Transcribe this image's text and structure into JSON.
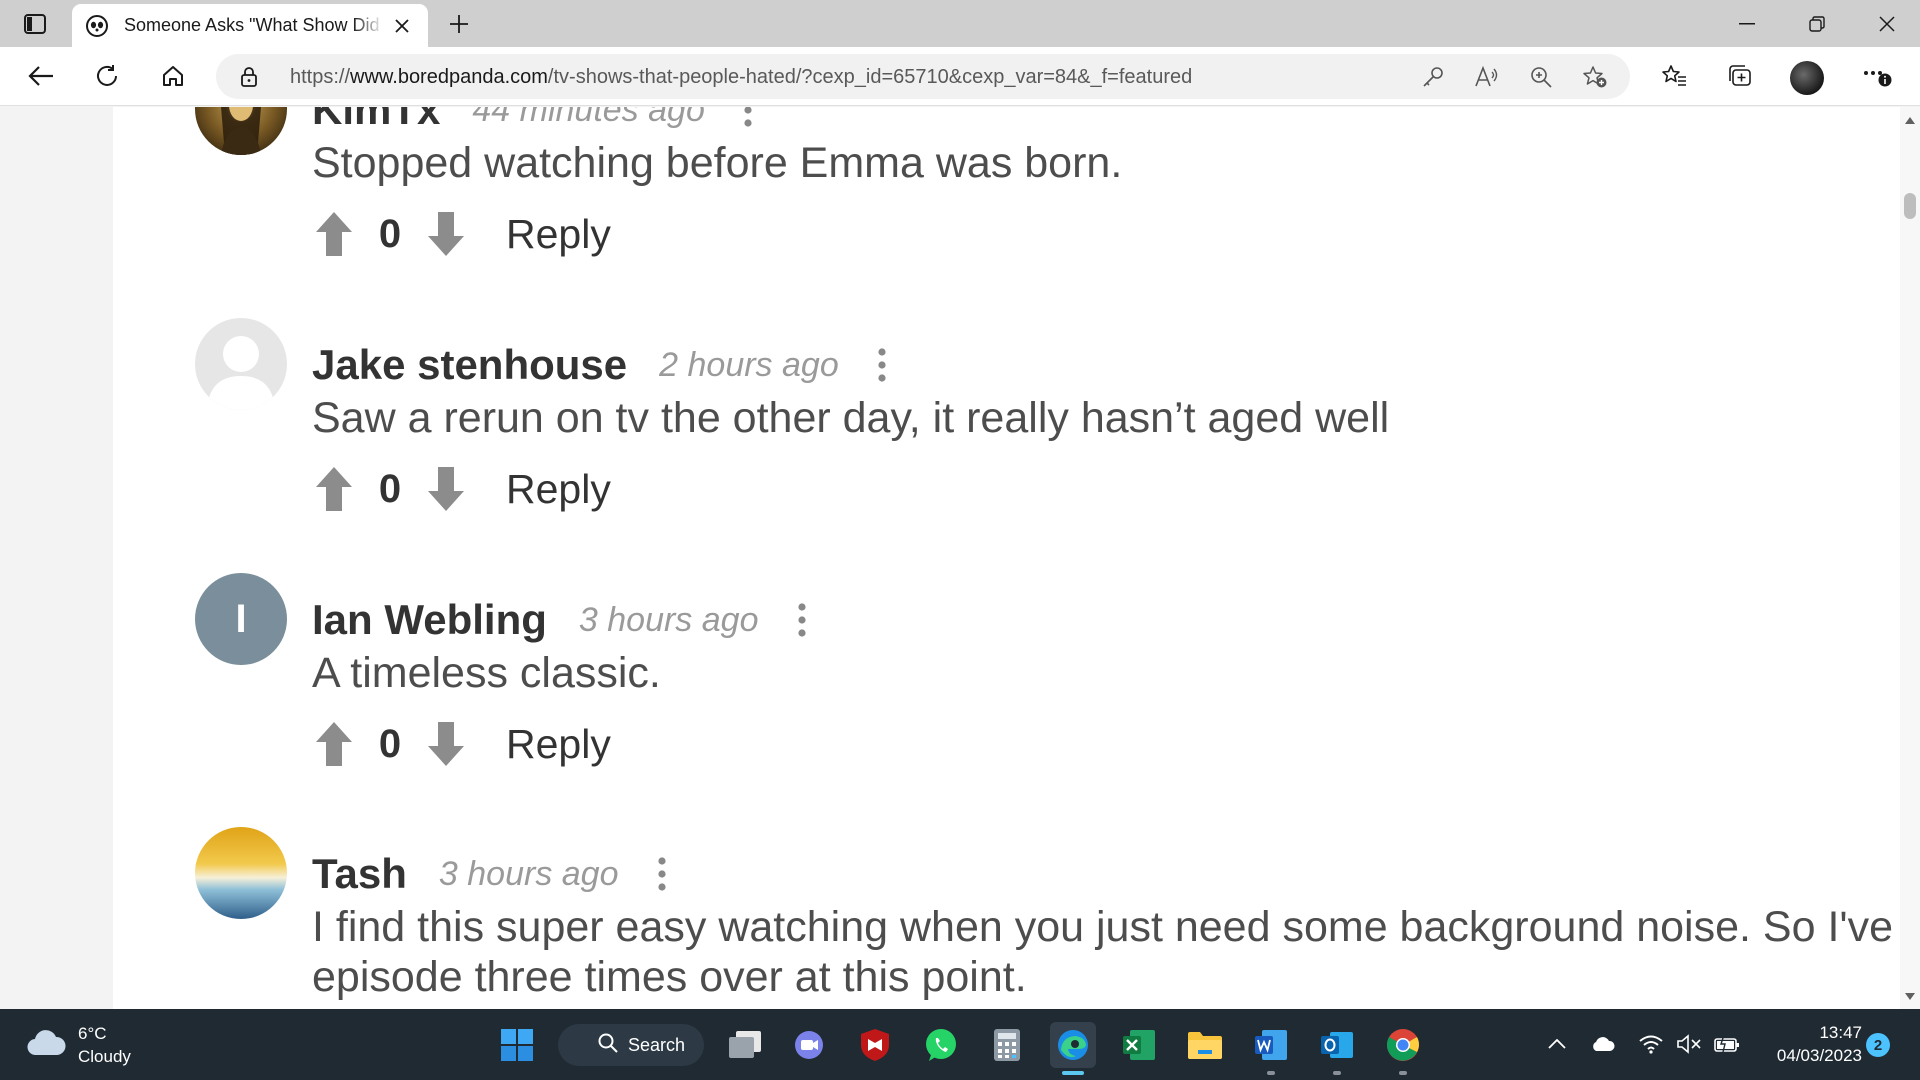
{
  "browser": {
    "tab": {
      "title": "Someone Asks \"What Show Did You Love That Everyone Hated\""
    },
    "address": {
      "url_prefix": "https://",
      "url_host": "www.boredpanda.com",
      "url_path": "/tv-shows-that-people-hated/?cexp_id=65710&cexp_var=84&_f=featured"
    },
    "icons": {
      "tab_actions": "tab-actions-icon",
      "back": "back-arrow-icon",
      "refresh": "refresh-icon",
      "home": "home-icon",
      "lock": "lock-icon",
      "key": "key-icon",
      "read_aloud": "read-aloud-icon",
      "zoom": "zoom-icon",
      "add_favorite": "add-favorite-icon",
      "favorites": "favorites-icon",
      "collections": "collections-icon",
      "more": "more-icon"
    }
  },
  "comments": [
    {
      "author": "KimTx",
      "time": "44 minutes ago",
      "text": "Stopped watching before Emma was born.",
      "score": "0",
      "reply_label": "Reply",
      "avatar": "mona-lisa"
    },
    {
      "author": "Jake stenhouse",
      "time": "2 hours ago",
      "text": "Saw a rerun on tv the other day, it really hasn’t aged well",
      "score": "0",
      "reply_label": "Reply",
      "avatar": "default-person"
    },
    {
      "author": "Ian Webling",
      "time": "3 hours ago",
      "text": "A timeless classic.",
      "score": "0",
      "reply_label": "Reply",
      "avatar": "initial",
      "avatar_initial": "I"
    },
    {
      "author": "Tash",
      "time": "3 hours ago",
      "text": "I find this super easy watching when you just need some background noise. So I've p",
      "text_line2": "episode three times over at this point.",
      "score": "0",
      "reply_label": "Reply",
      "avatar": "sunset"
    }
  ],
  "taskbar": {
    "weather": {
      "temp": "6°C",
      "condition": "Cloudy"
    },
    "search_label": "Search",
    "apps": [
      "start",
      "search",
      "task-view",
      "teams",
      "mcafee",
      "whatsapp",
      "calculator",
      "edge",
      "excel",
      "file-explorer",
      "word",
      "outlook",
      "chrome"
    ],
    "clock": {
      "time": "13:47",
      "date": "04/03/2023"
    },
    "notification_count": "2"
  },
  "colors": {
    "accent": "#0078d4",
    "text_dark": "#333333",
    "text_body": "#4d4d4d",
    "text_muted": "#9a9a9a",
    "taskbar": "#1f2a33"
  }
}
